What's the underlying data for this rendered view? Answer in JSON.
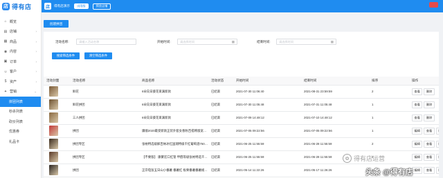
{
  "logo": {
    "mark": "店",
    "text": "得有店"
  },
  "topbar": {
    "app_icon": "店",
    "app_name": "得有店演示",
    "trial_badge": "试用版",
    "preview_button": "预览店铺"
  },
  "sidebar": {
    "items": [
      {
        "icon": "home-icon",
        "glyph": "⌂",
        "label": "概览",
        "chevron": ""
      },
      {
        "icon": "store-icon",
        "glyph": "▤",
        "label": "店铺",
        "chevron": "›"
      },
      {
        "icon": "goods-icon",
        "glyph": "▦",
        "label": "商品",
        "chevron": "›"
      },
      {
        "icon": "content-icon",
        "glyph": "◉",
        "label": "内容",
        "chevron": "›"
      },
      {
        "icon": "order-icon",
        "glyph": "▣",
        "label": "订单",
        "chevron": "›"
      },
      {
        "icon": "customer-icon",
        "glyph": "☺",
        "label": "客户",
        "chevron": "›"
      },
      {
        "icon": "asset-icon",
        "glyph": "$",
        "label": "资产",
        "chevron": "›"
      },
      {
        "icon": "marketing-icon",
        "glyph": "✦",
        "label": "营销",
        "chevron": "⌄"
      }
    ],
    "sub_items": [
      "拼团列表",
      "秒杀列表",
      "砍价列表",
      "优惠券",
      "礼品卡"
    ]
  },
  "create_button": "创建拼团",
  "filter": {
    "name_label": "活动名称:",
    "name_placeholder": "请输入活动名称",
    "start_label": "开始时间:",
    "start_placeholder": "请选择时间",
    "end_label": "结束时间:",
    "end_placeholder": "请选择时间",
    "search_button": "搜索筛选条件",
    "clear_button": "清空筛选条件"
  },
  "table": {
    "headers": [
      "活动封面",
      "活动名称",
      "商品名称",
      "活动状态",
      "开始时间",
      "结束时间",
      "排序",
      "操作"
    ],
    "rows": [
      {
        "thumb": "#7a5a38",
        "name": "鲜花",
        "product": "6朵向日葵花束满新款",
        "status": "已结束",
        "start": "2021-07-30 11:06:40",
        "end": "2021-08-31 23:59:59",
        "sort": "2",
        "ops": [
          "查看",
          "删除"
        ]
      },
      {
        "thumb": "#6e5230",
        "name": "鲜花拼团",
        "product": "6朵向日葵花束满新款",
        "status": "已结束",
        "start": "2021-07-30 11:05:48",
        "end": "2021-07-31 11:05:48",
        "sort": "1",
        "ops": [
          "查看",
          "删除"
        ]
      },
      {
        "thumb": "#8a6a42",
        "name": "三人拼团",
        "product": "6朵向日葵花束满新款",
        "status": "已结束",
        "start": "2021-07-09 14:48:12",
        "end": "2021-07-10 14:48:12",
        "sort": "1",
        "ops": [
          "查看",
          "删除"
        ]
      },
      {
        "thumb": "#c23a3a",
        "name": "拼团",
        "product": "康顺2020最受新款正装外套女春秋百搭韩版宽松二八分外套女先发",
        "status": "已结束",
        "start": "2021-07-05 09:22:56",
        "end": "2021-07-05 09:22:56",
        "sort": "1",
        "ops": [
          "编辑",
          "查看",
          "删除"
        ]
      },
      {
        "thumb": "#3a2a1c",
        "name": "拼团专区",
        "product": "张裕特选级解百纳冰红国潮特级干红葡萄酒750ml*6 六支",
        "status": "已结束",
        "start": "2021-06-25 11:55:59",
        "end": "2021-06-28 11:55:59",
        "sort": "2",
        "ops": [
          "编辑",
          "查看",
          "删除"
        ]
      },
      {
        "thumb": "#5a3a28",
        "name": "拼团专区",
        "product": "【不要版】 康聚宏口红管 甲醛等级张裕特选干红葡萄酒750ml",
        "status": "已结束",
        "start": "2021-06-25 11:55:59",
        "end": "2021-06-28 11:55:59",
        "sort": "2",
        "ops": [
          "编辑",
          "查看",
          "删除"
        ]
      },
      {
        "thumb": "#2a2420",
        "name": "拼团",
        "product": "正宗电饭五日山小番薯 番薯红 板栗番薯番薯规格新鲜红薯地瓜超甜 宝宝",
        "status": "已结束",
        "start": "2021-05-14 11:22:26",
        "end": "2021-05-17 11:26:26",
        "sort": "2",
        "ops": [
          "编辑",
          "查看",
          "删除"
        ]
      }
    ]
  },
  "overlay": {
    "watermark_glyph": "✿",
    "watermark_text": "得有店运营",
    "credit": "头条 @得有店"
  }
}
